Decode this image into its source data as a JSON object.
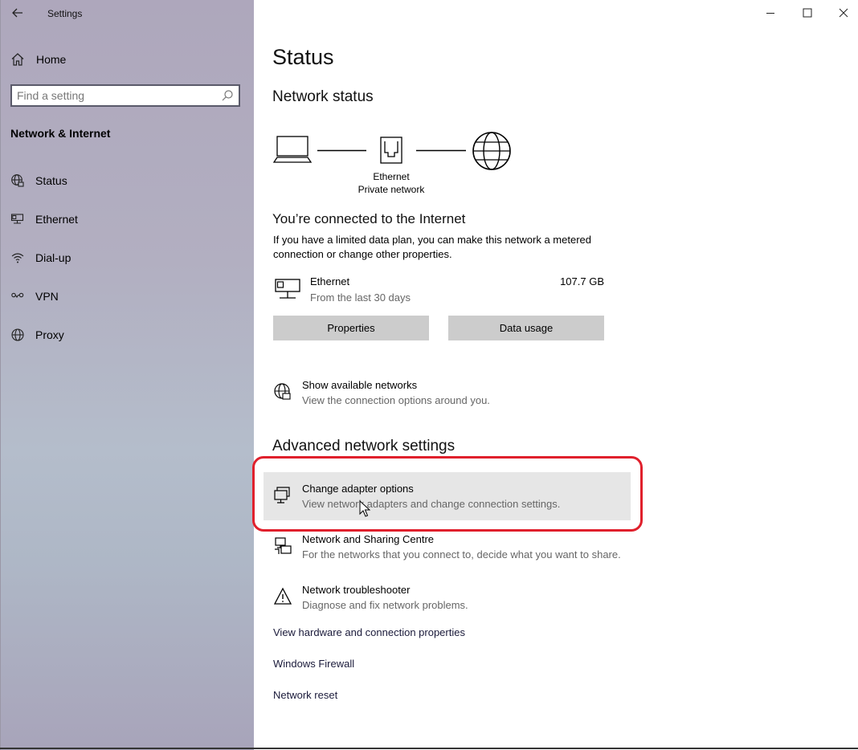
{
  "window": {
    "title": "Settings",
    "controls": [
      "minimize",
      "maximize",
      "close"
    ]
  },
  "sidebar": {
    "home_label": "Home",
    "search_placeholder": "Find a setting",
    "section_title": "Network & Internet",
    "items": [
      {
        "label": "Status",
        "icon": "globe-network-icon"
      },
      {
        "label": "Ethernet",
        "icon": "ethernet-icon"
      },
      {
        "label": "Dial-up",
        "icon": "dialup-icon"
      },
      {
        "label": "VPN",
        "icon": "vpn-icon"
      },
      {
        "label": "Proxy",
        "icon": "globe-icon"
      }
    ]
  },
  "main": {
    "title": "Status",
    "network_status_heading": "Network status",
    "diagram": {
      "label_line1": "Ethernet",
      "label_line2": "Private network"
    },
    "connected_heading": "You’re connected to the Internet",
    "connected_desc": "If you have a limited data plan, you can make this network a metered connection or change other properties.",
    "connection": {
      "name": "Ethernet",
      "period": "From the last 30 days",
      "usage": "107.7 GB"
    },
    "buttons": {
      "properties": "Properties",
      "data_usage": "Data usage"
    },
    "show_networks": {
      "title": "Show available networks",
      "desc": "View the connection options around you."
    },
    "advanced_heading": "Advanced network settings",
    "advanced_items": [
      {
        "title": "Change adapter options",
        "desc": "View network adapters and change connection settings."
      },
      {
        "title": "Network and Sharing Centre",
        "desc": "For the networks that you connect to, decide what you want to share."
      },
      {
        "title": "Network troubleshooter",
        "desc": "Diagnose and fix network problems."
      }
    ],
    "links": [
      "View hardware and connection properties",
      "Windows Firewall",
      "Network reset"
    ]
  },
  "colors": {
    "highlight_outline": "#e0202c",
    "button_bg": "#cccccc",
    "hover_bg": "#e6e6e6"
  }
}
